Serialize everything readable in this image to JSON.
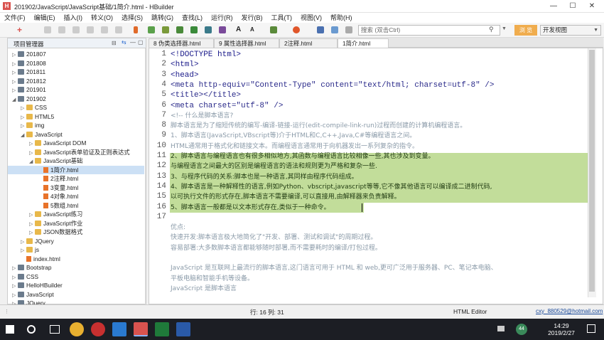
{
  "window": {
    "title": "201902/JavaScript/JavaScript基础/1简介.html - HBuilder",
    "app_icon": "H"
  },
  "menu": [
    "文件(F)",
    "编辑(E)",
    "插入(I)",
    "转义(O)",
    "选择(S)",
    "跳转(G)",
    "查找(L)",
    "运行(R)",
    "发行(B)",
    "工具(T)",
    "视图(V)",
    "帮助(H)"
  ],
  "toolbar": {
    "search_placeholder": "搜索 (双击Ctrl)",
    "browse_button": "浏 览",
    "view_select": "开发视图"
  },
  "sidebar": {
    "title": "项目管理器",
    "tree": [
      {
        "label": "201807",
        "level": 0,
        "type": "project",
        "expanded": false
      },
      {
        "label": "201808",
        "level": 0,
        "type": "project",
        "expanded": false
      },
      {
        "label": "201811",
        "level": 0,
        "type": "project",
        "expanded": false
      },
      {
        "label": "201812",
        "level": 0,
        "type": "project",
        "expanded": false
      },
      {
        "label": "201901",
        "level": 0,
        "type": "project",
        "expanded": false
      },
      {
        "label": "201902",
        "level": 0,
        "type": "project",
        "expanded": true
      },
      {
        "label": "CSS",
        "level": 1,
        "type": "folder",
        "expanded": false
      },
      {
        "label": "HTML5",
        "level": 1,
        "type": "folder",
        "expanded": false
      },
      {
        "label": "img",
        "level": 1,
        "type": "folder",
        "expanded": false
      },
      {
        "label": "JavaScript",
        "level": 1,
        "type": "folder",
        "expanded": true
      },
      {
        "label": "JavaScript DOM",
        "level": 2,
        "type": "folder",
        "expanded": false
      },
      {
        "label": "JavaScript表单验证及正则表达式",
        "level": 2,
        "type": "folder",
        "expanded": false
      },
      {
        "label": "JavaScript基础",
        "level": 2,
        "type": "folder",
        "expanded": true
      },
      {
        "label": "1简介.html",
        "level": 3,
        "type": "file",
        "selected": true
      },
      {
        "label": "2注释.html",
        "level": 3,
        "type": "file"
      },
      {
        "label": "3变量.html",
        "level": 3,
        "type": "file"
      },
      {
        "label": "4对象.html",
        "level": 3,
        "type": "file"
      },
      {
        "label": "5数组.html",
        "level": 3,
        "type": "file"
      },
      {
        "label": "JavaScript练习",
        "level": 2,
        "type": "folder",
        "expanded": false
      },
      {
        "label": "JavaScript作业",
        "level": 2,
        "type": "folder",
        "expanded": false
      },
      {
        "label": "JSON数据格式",
        "level": 2,
        "type": "folder",
        "expanded": false
      },
      {
        "label": "JQuery",
        "level": 1,
        "type": "folder",
        "expanded": false
      },
      {
        "label": "js",
        "level": 1,
        "type": "folder",
        "expanded": false
      },
      {
        "label": "index.html",
        "level": 1,
        "type": "file"
      },
      {
        "label": "Bootstrap",
        "level": 0,
        "type": "project",
        "expanded": false
      },
      {
        "label": "CSS",
        "level": 0,
        "type": "project",
        "expanded": false
      },
      {
        "label": "HelloHBuilder",
        "level": 0,
        "type": "project",
        "expanded": false
      },
      {
        "label": "JavaScript",
        "level": 0,
        "type": "project",
        "expanded": false
      },
      {
        "label": "JQuery",
        "level": 0,
        "type": "project",
        "expanded": false
      }
    ]
  },
  "editor_tabs": [
    {
      "label": "8 伪类选择器.html",
      "active": false
    },
    {
      "label": "9 属性选择器.html",
      "active": false
    },
    {
      "label": "2注释.html",
      "active": false
    },
    {
      "label": "1简介.html",
      "active": true
    }
  ],
  "editor": {
    "line_numbers": [
      "1",
      "2",
      "3",
      "4",
      "5",
      "6",
      "7",
      "8",
      "9",
      "10",
      "11",
      "12",
      "13",
      "14",
      "15",
      "16",
      "17"
    ],
    "lines": [
      "<!DOCTYPE html>",
      "<html>",
      "<head>",
      "    <meta http-equiv=\"Content-Type\" content=\"text/html; charset=utf-8\" />",
      "    <title></title>",
      "    <meta charset=\"utf-8\" />",
      "    <!-- 什么是脚本语言?",
      "脚本语言是为了缩短传统的编写-编译-链接-运行(edit-compile-link-run)过程而创建的计算机编程语言。",
      "    1、脚本语言(JavaScript,VBscript等)介于HTML和C,C++,Java,C#等编程语言之间。",
      "  HTML通常用于格式化和链接文本。而编程语言通常用于向机器发出一系列复杂的指令。",
      "    2、脚本语言与编程语言也有很多相似地方,其函数与编程语言比较相像一些,其也涉及到变量。",
      " 与编程语言之间最大的区别是编程语言的语法和规则更为严格和复杂一些.",
      "    3、与程序代码的关系:脚本也是一种语言,其同样由程序代码组成。",
      "    4、脚本语言是一种解释性的语言,例如Python、vbscript,javascript等等,它不像其他语言可以编译成二进制代码,",
      " 以可执行文件的形式存在,脚本语言不需要编译,可以直接用,由解释器来负责解释。",
      "    5、脚本语言一般都是以文本形式存在,类似于一种命令。",
      "",
      " 优点:",
      " 快速开发:脚本语言极大地简化了\"开发、部署、测试和调试\"的周期过程。",
      " 容易部署:大多数脚本语言都能够随时部署,而不需要耗时的编译/打包过程。",
      "",
      "    JavaScript 是互联网上最流行的脚本语言,这门语言可用于 HTML 和 web,更可广泛用于服务器、PC、笔记本电脑、",
      " 平板电脑和智能手机等设备。",
      "    JavaScript 是脚本语言"
    ]
  },
  "status": {
    "position": "行: 16 列: 31",
    "mode": "HTML Editor",
    "user": "cxy_880529@hotmail.com"
  },
  "taskbar": {
    "time": "14:29",
    "date": "2019/2/27",
    "badge": "44"
  }
}
